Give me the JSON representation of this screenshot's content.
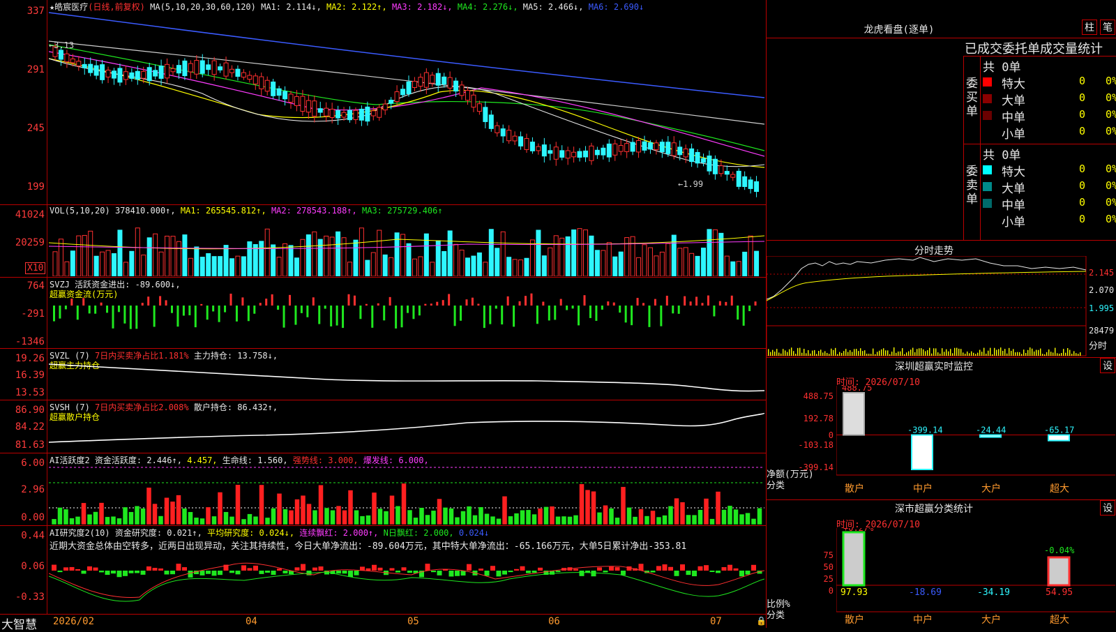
{
  "stock": {
    "name": "★皓宸医疗",
    "mode": "(日线,前复权)",
    "ma_label": "MA(5,10,20,30,60,120)",
    "ma": [
      {
        "label": "MA1:",
        "value": "2.114↓",
        "color": "#e8e8e8"
      },
      {
        "label": "MA2:",
        "value": "2.122↑",
        "color": "#ffff00"
      },
      {
        "label": "MA3:",
        "value": "2.182↓",
        "color": "#ff3cff"
      },
      {
        "label": "MA4:",
        "value": "2.276↓",
        "color": "#1fe81f"
      },
      {
        "label": "MA5:",
        "value": "2.466↓",
        "color": "#e8e8e8"
      },
      {
        "label": "MA6:",
        "value": "2.690↓",
        "color": "#3b5bff"
      }
    ],
    "price_axis": [
      "337",
      "291",
      "245",
      "199"
    ],
    "high_mark": "←3.13",
    "low_mark": "←1.99"
  },
  "volume": {
    "label": "VOL(5,10,20)",
    "value": "378410.000↑,",
    "ma1": "MA1: 265545.812↑,",
    "ma2": "MA2: 278543.188↑,",
    "ma3": "MA3: 275729.406↑",
    "axis": [
      "41024",
      "20259"
    ],
    "unit": "X10"
  },
  "svzj": {
    "title": "SVZJ  活跃资金进出: -89.600↓,",
    "subtitle": "超赢资金流(万元)",
    "axis": [
      "764",
      "-291",
      "-1346"
    ]
  },
  "svzl": {
    "title": "SVZL (7)",
    "ratio": "7日内买卖净占比1.181%",
    "hold": "主力持仓: 13.758↓,",
    "subtitle": "超赢主力持仓",
    "axis": [
      "19.26",
      "16.39",
      "13.53"
    ]
  },
  "svsh": {
    "title": "SVSH (7)",
    "ratio": "7日内买卖净占比2.008%",
    "hold": "散户持仓: 86.432↑,",
    "subtitle": "超赢散户持仓",
    "axis": [
      "86.90",
      "84.22",
      "81.63"
    ]
  },
  "ai_active": {
    "title": "AI活跃度2",
    "a": "资金活跃度: 2.446↑,",
    "b": "4.457,",
    "c": "生命线: 1.560,",
    "d": "强势线: 3.000,",
    "e": "爆发线: 6.000,",
    "axis": [
      "6.00",
      "2.96",
      "0.00"
    ]
  },
  "ai_research": {
    "title": "AI研究度2(10)",
    "a": "资金研究度: 0.021↑,",
    "b": "平均研究度: 0.024↓,",
    "c": "连续飘红: 2.000↑,",
    "d": "N日飘红: 2.000,",
    "e": "0.024↓",
    "comment": "近期大资金总体由空转多，近两日出现异动，关注其持续性，今日大单净流出：-89.604万元，其中特大单净流出：-65.166万元，大单5日累计净出-353.81",
    "axis": [
      "0.44",
      "0.06",
      "-0.33"
    ]
  },
  "bottom_bar": {
    "brand": "大智慧",
    "dates": [
      "2026/02",
      "04",
      "05",
      "06",
      "07"
    ]
  },
  "longhu": {
    "title": "龙虎看盘(逐单)",
    "btn1": "柱",
    "btn2": "笔",
    "header": "已成交委托单成交量统计",
    "buy_label": "委买单",
    "buy_total": "共 0单",
    "buy_rows": [
      {
        "name": "特大",
        "v1": "0",
        "v2": "0%",
        "color": "#ff0000"
      },
      {
        "name": "大单",
        "v1": "0",
        "v2": "0%",
        "color": "#8a0000"
      },
      {
        "name": "中单",
        "v1": "0",
        "v2": "0%",
        "color": "#6a0000"
      },
      {
        "name": "小单",
        "v1": "0",
        "v2": "0%",
        "color": ""
      }
    ],
    "sell_label": "委卖单",
    "sell_total": "共 0单",
    "sell_rows": [
      {
        "name": "特大",
        "v1": "0",
        "v2": "0%",
        "color": "#00ffff"
      },
      {
        "name": "大单",
        "v1": "0",
        "v2": "0%",
        "color": "#008a8a"
      },
      {
        "name": "中单",
        "v1": "0",
        "v2": "0%",
        "color": "#006a6a"
      },
      {
        "name": "小单",
        "v1": "0",
        "v2": "0%",
        "color": ""
      }
    ]
  },
  "fenshi": {
    "title": "分时走势",
    "axis": [
      "2.145",
      "2.070",
      "1.995",
      "28479",
      "分时"
    ]
  },
  "sz_monitor": {
    "title": "深圳超赢实时监控",
    "btn": "设",
    "time": "时间: 2026/07/10",
    "axis": [
      "488.75",
      "192.78",
      "0",
      "-103.18",
      "-399.14"
    ],
    "unit": "净额(万元)",
    "cat_label": "分类",
    "cats": [
      "散户",
      "中户",
      "大户",
      "超大"
    ],
    "values": [
      "488.75",
      "-399.14",
      "-24.44",
      "-65.17"
    ]
  },
  "sz_stat": {
    "title": "深市超赢分类统计",
    "btn": "设",
    "time": "时间: 2026/07/10",
    "axis": [
      "75",
      "50",
      "25",
      "0"
    ],
    "unit": "比例%",
    "cat_label": "分类",
    "cats": [
      "散户",
      "中户",
      "大户",
      "超大"
    ],
    "top_labels": [
      "+0.27%",
      "-0.04%"
    ],
    "values": [
      "97.93",
      "-18.69",
      "-34.19",
      "54.95"
    ]
  }
}
